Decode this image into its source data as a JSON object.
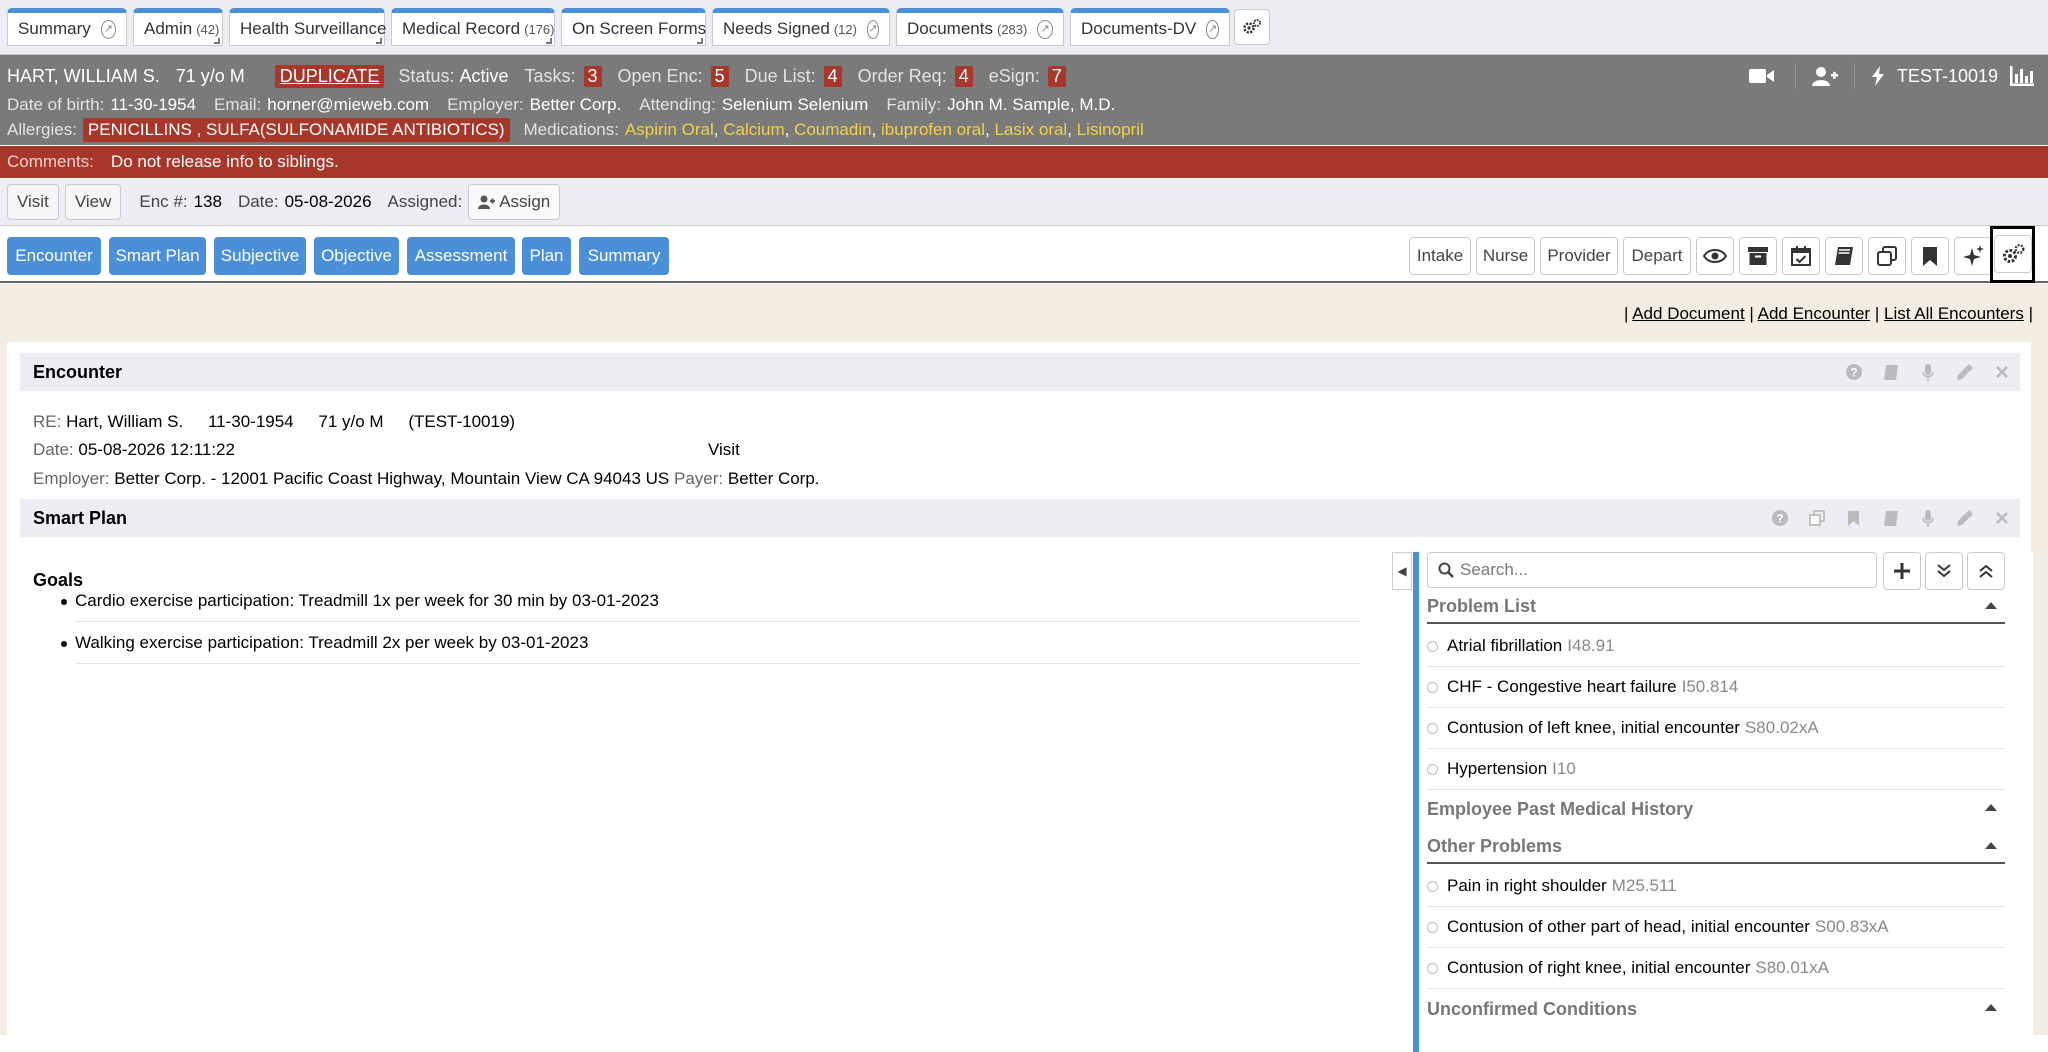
{
  "tabs": [
    {
      "label": "Summary",
      "count": "",
      "popout": true
    },
    {
      "label": "Admin",
      "count": "(42)",
      "popout": false
    },
    {
      "label": "Health Surveillance",
      "count": "",
      "popout": false
    },
    {
      "label": "Medical Record",
      "count": "(176)",
      "popout": false
    },
    {
      "label": "On Screen Forms",
      "count": "",
      "popout": false
    },
    {
      "label": "Needs Signed",
      "count": "(12)",
      "popout": true
    },
    {
      "label": "Documents",
      "count": "(283)",
      "popout": true
    },
    {
      "label": "Documents-DV",
      "count": "",
      "popout": true
    }
  ],
  "patient": {
    "name": "HART, WILLIAM S.",
    "age_sex": "71 y/o M",
    "duplicate": "DUPLICATE",
    "status_label": "Status:",
    "status": "Active",
    "tasks_label": "Tasks:",
    "tasks": "3",
    "open_enc_label": "Open Enc:",
    "open_enc": "5",
    "due_list_label": "Due List:",
    "due_list": "4",
    "order_req_label": "Order Req:",
    "order_req": "4",
    "esign_label": "eSign:",
    "esign": "7",
    "id": "TEST-10019",
    "dob_label": "Date of birth:",
    "dob": "11-30-1954",
    "email_label": "Email:",
    "email": "horner@mieweb.com",
    "employer_label": "Employer:",
    "employer": "Better Corp.",
    "attending_label": "Attending:",
    "attending": "Selenium Selenium",
    "family_label": "Family:",
    "family": "John M. Sample, M.D.",
    "allergies_label": "Allergies:",
    "allergies": "PENICILLINS , SULFA(SULFONAMIDE ANTIBIOTICS)",
    "medications_label": "Medications:",
    "medications": [
      "Aspirin Oral",
      "Calcium",
      "Coumadin",
      "ibuprofen oral",
      "Lasix oral",
      "Lisinopril"
    ],
    "comments_label": "Comments:",
    "comments": "Do not release info to siblings."
  },
  "visitbar": {
    "visit": "Visit",
    "view": "View",
    "enc_label": "Enc #:",
    "enc": "138",
    "date_label": "Date:",
    "date": "05-08-2026",
    "assigned_label": "Assigned:",
    "assign": "Assign"
  },
  "nav": {
    "left": [
      "Encounter",
      "Smart Plan",
      "Subjective",
      "Objective",
      "Assessment",
      "Plan",
      "Summary"
    ],
    "right": [
      "Intake",
      "Nurse",
      "Provider",
      "Depart"
    ]
  },
  "links": {
    "add_document": "Add Document",
    "add_encounter": "Add Encounter",
    "list_all": "List All Encounters",
    "sep": "|"
  },
  "encounter": {
    "title": "Encounter",
    "re_label": "RE:",
    "re_name": "Hart, William S.",
    "re_dob": "11-30-1954",
    "re_age": "71 y/o M",
    "re_id": "(TEST-10019)",
    "date_label": "Date:",
    "date": "05-08-2026 12:11:22",
    "type": "Visit",
    "employer_label": "Employer:",
    "employer": "Better Corp. - 12001 Pacific Coast Highway, Mountain View CA 94043 US",
    "payer_label": "Payer:",
    "payer": "Better Corp."
  },
  "smartplan": {
    "title": "Smart Plan",
    "goals_title": "Goals",
    "goals": [
      "Cardio exercise participation: Treadmill 1x per week for 30 min by 03-01-2023",
      "Walking exercise participation: Treadmill 2x per week by 03-01-2023"
    ],
    "search_placeholder": "Search...",
    "problem_list_title": "Problem List",
    "problems": [
      {
        "name": "Atrial fibrillation",
        "code": "I48.91"
      },
      {
        "name": "CHF - Congestive heart failure",
        "code": "I50.814"
      },
      {
        "name": "Contusion of left knee, initial encounter",
        "code": "S80.02xA"
      },
      {
        "name": "Hypertension",
        "code": "I10"
      }
    ],
    "employee_pmh_title": "Employee Past Medical History",
    "other_problems_title": "Other Problems",
    "other_problems": [
      {
        "name": "Pain in right shoulder",
        "code": "M25.511"
      },
      {
        "name": "Contusion of other part of head, initial encounter",
        "code": "S00.83xA"
      },
      {
        "name": "Contusion of right knee, initial encounter",
        "code": "S80.01xA"
      }
    ],
    "unconfirmed_title": "Unconfirmed Conditions"
  },
  "colors": {
    "accent": "#4a8fd8",
    "alert": "#a8372b",
    "medication": "#f2d048",
    "patient_bar": "#7a7a7a"
  }
}
